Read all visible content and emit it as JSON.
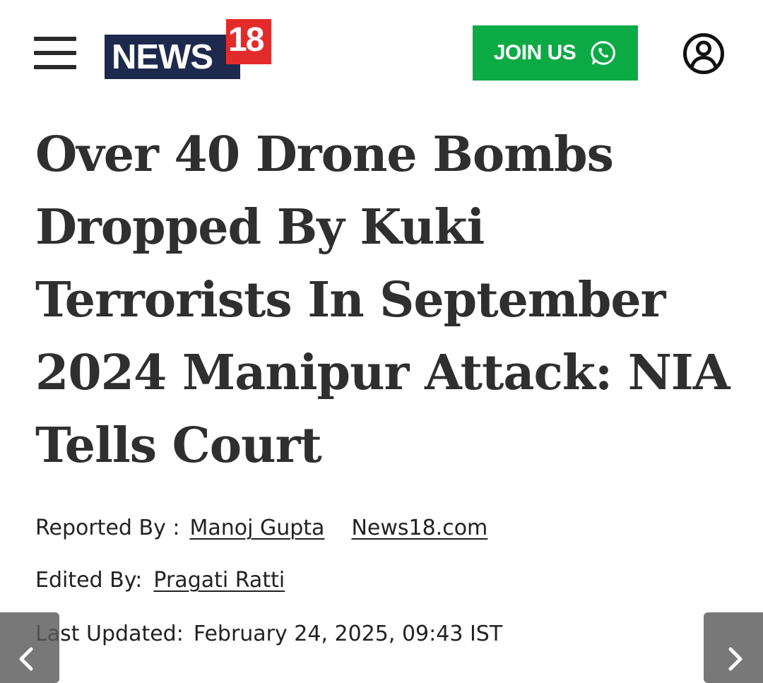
{
  "header": {
    "menu_icon": "hamburger-menu-icon",
    "logo": {
      "primary": "NEWS",
      "badge": "18",
      "navy": "#1d2a4d",
      "red": "#e42b2b"
    },
    "join_button": {
      "label": "JOIN US",
      "icon": "whatsapp-icon",
      "color": "#0caa45"
    },
    "profile_icon": "user-account-icon"
  },
  "article": {
    "headline": "Over 40 Drone Bombs Dropped By Kuki Terrorists In September 2024 Manipur Attack: NIA Tells Court",
    "reported_by_label": "Reported By :",
    "author": "Manoj Gupta",
    "source": "News18.com",
    "edited_by_label": "Edited By:",
    "editor": "Pragati Ratti",
    "last_updated_label": "Last Updated:",
    "last_updated": "February 24, 2025, 09:43 IST"
  },
  "navigation": {
    "prev_icon": "chevron-left-icon",
    "next_icon": "chevron-right-icon"
  }
}
